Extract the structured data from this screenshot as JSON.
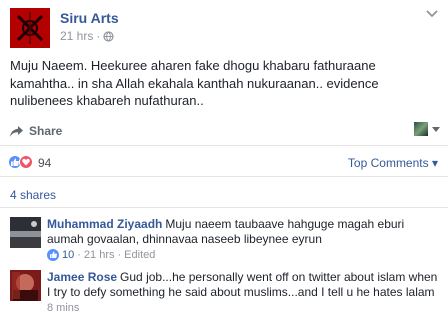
{
  "post": {
    "page_name": "Siru Arts",
    "time": "21 hrs",
    "separator": "·",
    "text": "Muju Naeem. Heekuree aharen fake dhogu khabaru fathuraane kamahtha.. in sha Allah ekahala kanthah nukuraanan.. evidence nulibenees khabareh nufathuran.."
  },
  "actions": {
    "share_label": "Share"
  },
  "reactions": {
    "count": "94",
    "sort_label": "Top Comments",
    "sort_caret": "▾"
  },
  "shares": {
    "label": "4 shares"
  },
  "comments": [
    {
      "author": "Muhammad Ziyaadh",
      "text": "Muju naeem taubaave hahguge magah eburi aumah govaalan, dhinnavaa naseeb libeynee eyrun",
      "likes": "10",
      "separator": "·",
      "time": "21 hrs",
      "edited": "Edited"
    },
    {
      "author": "Jamee Rose",
      "text": "Gud job...he personally went off on twitter about islam when I try to defy something he said about muslims...and I tell u he hates lalam",
      "time": "8 mins"
    }
  ],
  "colors": {
    "link_blue": "#365899",
    "meta_gray": "#90949c",
    "like_blue": "#5890ff",
    "love_red": "#f25268",
    "page_avatar_red": "#b30000"
  },
  "icons": [
    "globe-icon",
    "more-icon",
    "share-icon",
    "like-icon",
    "love-icon",
    "caret-icon"
  ]
}
